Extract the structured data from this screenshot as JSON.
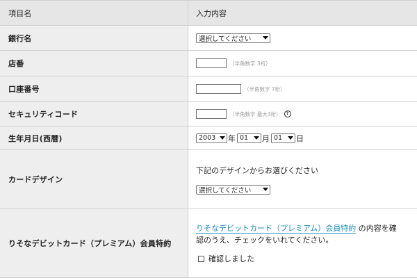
{
  "header": {
    "col1": "項目名",
    "col2": "入力内容"
  },
  "bank": {
    "label": "銀行名",
    "select_value": "選択してください"
  },
  "branch": {
    "label": "店番",
    "hint": "（半角数字 3桁）"
  },
  "account": {
    "label": "口座番号",
    "hint": "（半角数字 7桁）"
  },
  "security": {
    "label": "セキュリティコード",
    "hint": "（半角数字 最大3桁）",
    "help_glyph": "?"
  },
  "birth": {
    "label": "生年月日(西暦)",
    "year": "2003",
    "year_unit": "年",
    "month": "01",
    "month_unit": "月",
    "day": "01",
    "day_unit": "日"
  },
  "card_design": {
    "label": "カードデザイン",
    "instruction": "下記のデザインからお選びください",
    "select_value": "選択してください"
  },
  "terms": {
    "label": "りそなデビットカード（プレミアム）会員特約",
    "link_text": "りそなデビットカード（プレミアム）会員特約",
    "text_after_link": "の内容を確",
    "text_line2": "認のうえ、チェックをいれてください。",
    "checkbox_label": "確認しました"
  }
}
